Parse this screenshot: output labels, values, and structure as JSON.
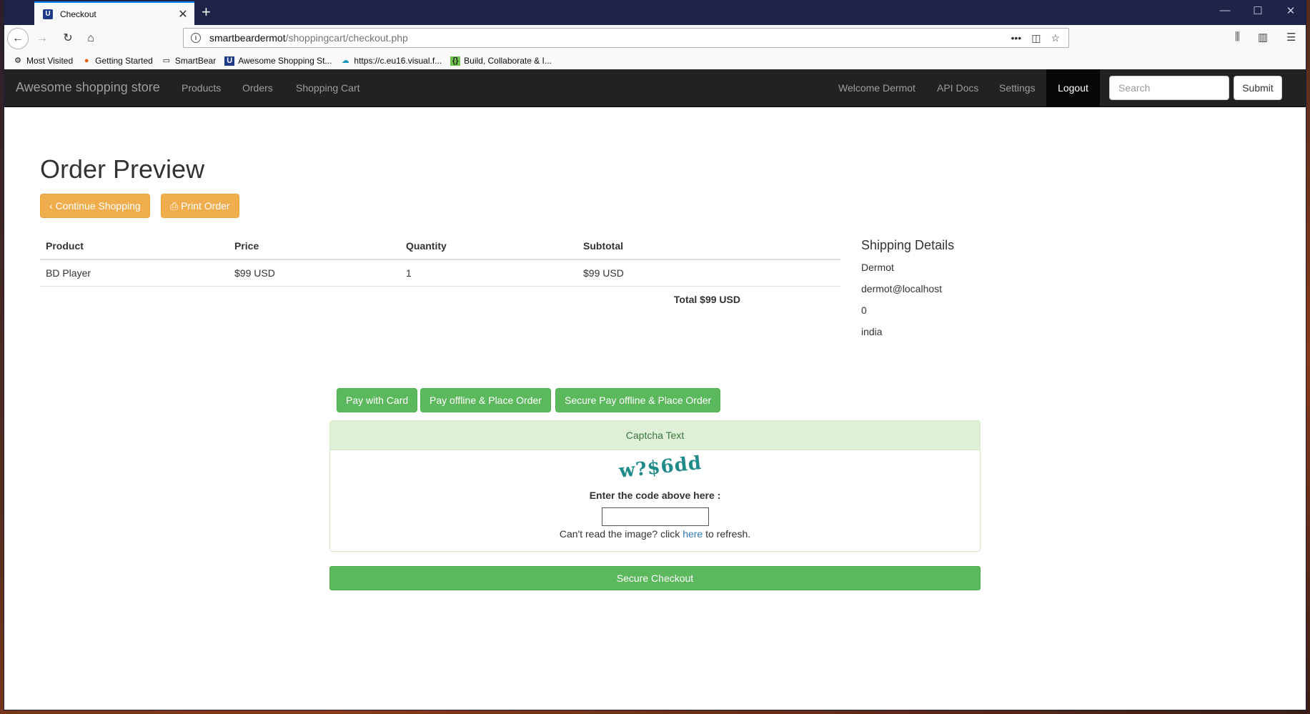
{
  "browser": {
    "tab_title": "Checkout",
    "url_host": "smartbeardermot",
    "url_path": "/shoppingcart/checkout.php",
    "bookmarks": [
      "Most Visited",
      "Getting Started",
      "SmartBear",
      "Awesome Shopping St...",
      "https://c.eu16.visual.f...",
      "Build, Collaborate & I..."
    ]
  },
  "navbar": {
    "brand": "Awesome shopping store",
    "links": [
      "Products",
      "Orders",
      "Shopping Cart"
    ],
    "right_links": [
      "Welcome Dermot",
      "API Docs",
      "Settings"
    ],
    "logout": "Logout",
    "search_placeholder": "Search",
    "submit": "Submit"
  },
  "page": {
    "title": "Order Preview",
    "continue_label": "Continue Shopping",
    "print_label": "Print Order"
  },
  "table": {
    "headers": [
      "Product",
      "Price",
      "Quantity",
      "Subtotal"
    ],
    "rows": [
      [
        "BD Player",
        "$99 USD",
        "1",
        "$99 USD"
      ]
    ],
    "total": "Total $99 USD"
  },
  "shipping": {
    "title": "Shipping Details",
    "name": "Dermot",
    "email": "dermot@localhost",
    "phone": "0",
    "country": "india"
  },
  "payment": {
    "pay_card": "Pay with Card",
    "pay_offline": "Pay offline & Place Order",
    "secure_pay_offline": "Secure Pay offline & Place Order"
  },
  "captcha": {
    "heading": "Captcha Text",
    "code": "w?$6dd",
    "label": "Enter the code above here :",
    "help_before": "Can't read the image? click ",
    "help_link": "here",
    "help_after": " to refresh."
  },
  "checkout": {
    "label": "Secure Checkout"
  }
}
